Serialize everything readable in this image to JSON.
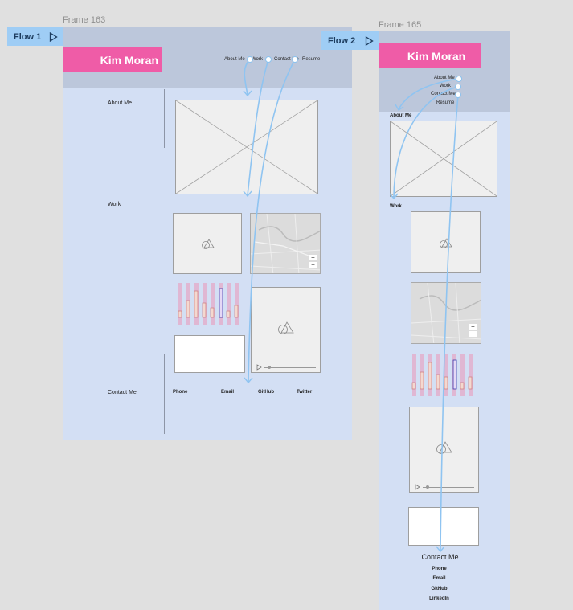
{
  "frame163": {
    "label": "Frame 163",
    "flow": "Flow 1",
    "name": "Kim Moran",
    "nav": [
      "About Me",
      "Work",
      "Contact Me",
      "Resume"
    ],
    "sections": {
      "about": "About Me",
      "work": "Work",
      "contact": "Contact Me"
    },
    "contacts": [
      "Phone",
      "Email",
      "GitHub",
      "Twitter"
    ]
  },
  "frame165": {
    "label": "Frame 165",
    "flow": "Flow 2",
    "name": "Kim Moran",
    "nav": [
      "About Me",
      "Work",
      "Contact Me",
      "Resume"
    ],
    "sections": {
      "about": "About Me",
      "work": "Work",
      "contact": "Contact Me"
    },
    "contacts": [
      "Phone",
      "Email",
      "GitHub",
      "LinkedIn"
    ]
  },
  "icons": {
    "play": "play-icon",
    "shapes": "shapes-icon",
    "zoom_in": "+",
    "zoom_out": "−"
  },
  "colors": {
    "brand_pink": "#ef5ca7",
    "frame_bg": "#d3dff4",
    "header_bg": "#bcc7db",
    "flow_blue": "#9fcdf5"
  }
}
